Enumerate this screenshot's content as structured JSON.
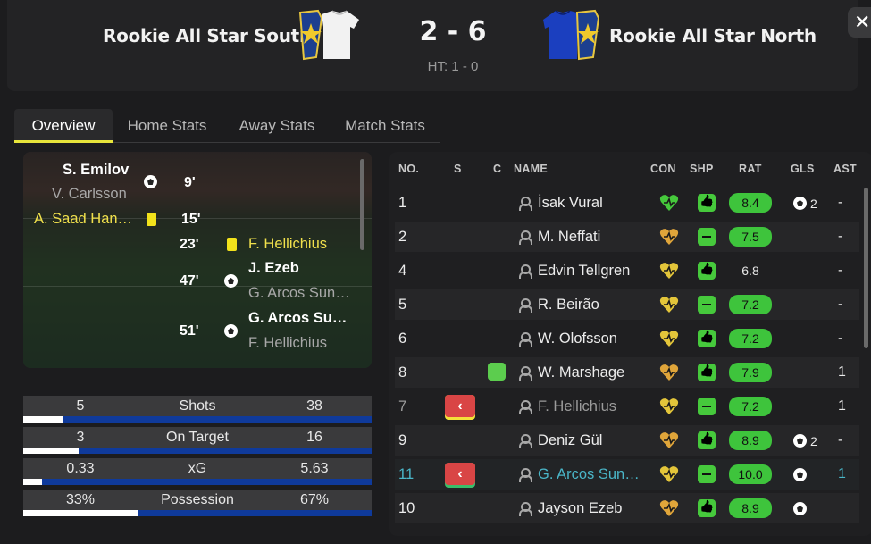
{
  "header": {
    "home_team": "Rookie All Star South",
    "away_team": "Rookie All Star North",
    "score": "2 - 6",
    "half_time": "HT: 1 - 0",
    "close_label": "✕"
  },
  "tabs": [
    "Overview",
    "Home Stats",
    "Away Stats",
    "Match Stats"
  ],
  "timeline": {
    "events": [
      {
        "player": "S. Emilov",
        "assist": "V. Carlsson",
        "minute": "9'",
        "side": "home",
        "type": "goal"
      },
      {
        "player": "A. Saad Han…",
        "minute": "15'",
        "side": "home",
        "type": "yellow"
      },
      {
        "player": "F. Hellichius",
        "minute": "23'",
        "side": "away",
        "type": "yellow"
      },
      {
        "player": "J. Ezeb",
        "assist": "G. Arcos Sun…",
        "minute": "47'",
        "side": "away",
        "type": "goal"
      },
      {
        "player": "G. Arcos Su…",
        "assist": "F. Hellichius",
        "minute": "51'",
        "side": "away",
        "type": "goal"
      }
    ]
  },
  "stats": [
    {
      "label": "Shots",
      "home": "5",
      "away": "38",
      "home_share": 0.116
    },
    {
      "label": "On Target",
      "home": "3",
      "away": "16",
      "home_share": 0.158
    },
    {
      "label": "xG",
      "home": "0.33",
      "away": "5.63",
      "home_share": 0.055
    },
    {
      "label": "Possession",
      "home": "33%",
      "away": "67%",
      "home_share": 0.33
    }
  ],
  "player_table": {
    "headers": [
      "NO.",
      "S",
      "C",
      "NAME",
      "CON",
      "SHP",
      "RAT",
      "GLS",
      "AST"
    ],
    "rows": [
      {
        "no": "1",
        "name": "İsak Vural",
        "con": "high",
        "shp": "up",
        "rat": "8.4",
        "rat_style": "green",
        "gls": "2",
        "ast": "-",
        "sub": ""
      },
      {
        "no": "2",
        "name": "M. Neffati",
        "con": "mid",
        "shp": "flat",
        "rat": "7.5",
        "rat_style": "green",
        "gls": "",
        "ast": "-",
        "sub": ""
      },
      {
        "no": "4",
        "name": "Edvin Tellgren",
        "con": "low",
        "shp": "up",
        "rat": "6.8",
        "rat_style": "plain",
        "gls": "",
        "ast": "-",
        "sub": ""
      },
      {
        "no": "5",
        "name": "R. Beirão",
        "con": "low",
        "shp": "flat",
        "rat": "7.2",
        "rat_style": "green",
        "gls": "",
        "ast": "-",
        "sub": ""
      },
      {
        "no": "6",
        "name": "W. Olofsson",
        "con": "low",
        "shp": "up",
        "rat": "7.2",
        "rat_style": "green",
        "gls": "",
        "ast": "-",
        "sub": ""
      },
      {
        "no": "8",
        "name": "W. Marshage",
        "con": "mid",
        "shp": "up",
        "rat": "7.9",
        "rat_style": "green",
        "gls": "",
        "ast": "1",
        "sub": "",
        "captain": true
      },
      {
        "no": "7",
        "name": "F. Hellichius",
        "con": "low",
        "shp": "flat",
        "rat": "7.2",
        "rat_style": "green",
        "gls": "",
        "ast": "1",
        "sub": "off-yellow"
      },
      {
        "no": "9",
        "name": "Deniz Gül",
        "con": "mid",
        "shp": "up",
        "rat": "8.9",
        "rat_style": "green",
        "gls": "2",
        "ast": "-",
        "sub": ""
      },
      {
        "no": "11",
        "name": "G. Arcos Sun…",
        "con": "low",
        "shp": "flat",
        "rat": "10.0",
        "rat_style": "green",
        "gls": "1",
        "ast": "1",
        "sub": "off-green",
        "highlight": true
      },
      {
        "no": "10",
        "name": "Jayson Ezeb",
        "con": "mid",
        "shp": "up",
        "rat": "8.9",
        "rat_style": "green",
        "gls": "1",
        "ast": "",
        "sub": ""
      }
    ]
  },
  "colors": {
    "tab_accent": "#e7e53b",
    "away_bar": "#0f3a9b",
    "rating_green": "#3ec43c",
    "highlight_teal": "#4ab6c8"
  }
}
